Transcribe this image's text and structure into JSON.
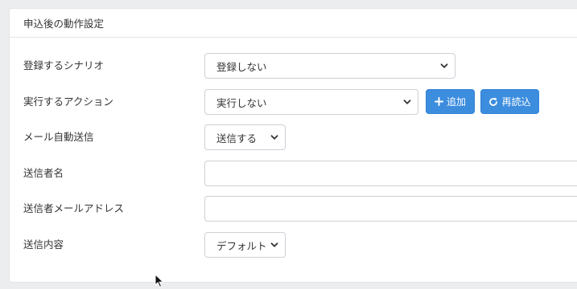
{
  "card": {
    "title": "申込後の動作設定"
  },
  "fields": {
    "scenario": {
      "label": "登録するシナリオ",
      "value": "登録しない"
    },
    "action": {
      "label": "実行するアクション",
      "value": "実行しない"
    },
    "add_button": {
      "label": "追加",
      "icon": "plus-icon"
    },
    "reload_button": {
      "label": "再読込",
      "icon": "reload-icon"
    },
    "auto_mail": {
      "label": "メール自動送信",
      "value": "送信する"
    },
    "sender_name": {
      "label": "送信者名",
      "value": ""
    },
    "sender_email": {
      "label": "送信者メールアドレス",
      "value": ""
    },
    "content": {
      "label": "送信内容",
      "value": "デフォルト"
    }
  },
  "colors": {
    "button": "#3c8dde",
    "border": "#ccd0d5",
    "page_bg": "#ecedef"
  }
}
